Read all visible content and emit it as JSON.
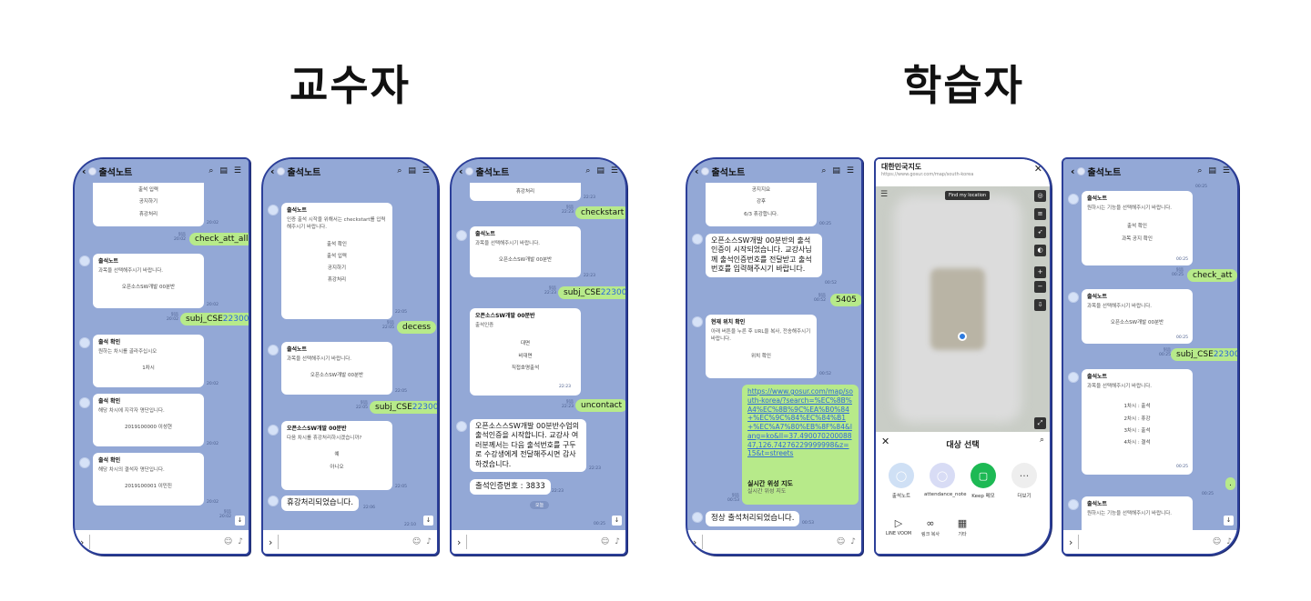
{
  "titles": {
    "professor": "교수자",
    "learner": "학습자"
  },
  "common": {
    "chat_title": "출석노트",
    "read": "읽음"
  },
  "p1": {
    "top_card": [
      "출석 입력",
      "공지하기",
      "휴강처리"
    ],
    "t1": "20:02",
    "b1": "check_att_all",
    "b1t": "20:02",
    "c2_title": "출석노트",
    "c2_text": "과목을 선택해주시기 바랍니다.",
    "c2_opt": "오픈소스SW개발 00분반",
    "c2t": "20:02",
    "b2a": "subj_CSE",
    "b2b": "22300",
    "b2t": "20:02",
    "c3_title": "출석 확인",
    "c3_text": "원하는 차시를 골라주십시오",
    "c3_opt": "1차시",
    "c3t": "20:02",
    "c4_title": "출석 확인",
    "c4_text": "해당 차시에 지각자 명단입니다.",
    "c4_opt": "2019100000 이성현",
    "c4t": "20:02",
    "c5_title": "출석 확인",
    "c5_text": "해당 차시의 결석자 명단입니다.",
    "c5_opt": "2019100001 이민진",
    "c5t": "20:02",
    "last_t": "20:02"
  },
  "p2": {
    "top_t": "22:05",
    "c1_title": "출석노트",
    "c1_text": "인증 출석 시작을 위해서는 checkstart를 입력해주시기 바랍니다.",
    "c1_opts": [
      "출석 확인",
      "출석 입력",
      "공지하기",
      "휴강처리"
    ],
    "c1t": "22:05",
    "b1": "decess",
    "b1t": "22:05",
    "c2_title": "출석노트",
    "c2_text": "과목을 선택해주시기 바랍니다.",
    "c2_opt": "오픈소스SW개발 00분반",
    "c2t": "22:05",
    "b2a": "subj_CSE",
    "b2b": "22300",
    "b2t": "22:05",
    "c3_title": "오픈소스SW개발 00분반",
    "c3_text": "다음 차시를 휴강처리하시겠습니까?",
    "c3_opts": [
      "예",
      "아니오"
    ],
    "c3t": "22:05",
    "w1": "휴강처리되었습니다.",
    "w1t": "22:06",
    "last_t": "22:10"
  },
  "p3": {
    "top_card": "휴강처리",
    "top_t": "22:23",
    "b1": "checkstart",
    "b1t": "22:23",
    "c1_title": "출석노트",
    "c1_text": "과목을 선택해주시기 바랍니다.",
    "c1_opt": "오픈소스SW개발 00분반",
    "c1t": "22:23",
    "b2a": "subj_CSE",
    "b2b": "22300",
    "b2t": "22:23",
    "c2_title": "오픈소스SW개발 00분반",
    "c2_text": "출석인증",
    "c2_opts": [
      "대면",
      "비대면",
      "직접호명출석"
    ],
    "c2t": "22:23",
    "b3": "uncontact",
    "b3t": "22:23",
    "w1": "오픈소스스SW개발 00분반수업의 출석인증을 시작합니다. 교강사 여러분께서는 다음 출석번호를 구두로 수강생에게 전달해주시면 감사하겠습니다.",
    "w1t": "22:23",
    "w2": "출석인증번호 : 3833",
    "w2t": "22:23",
    "pill": "오늘",
    "last_t": "00:25"
  },
  "p4": {
    "top_card": [
      "공지지요",
      "강후",
      "6/3 휴강합니다."
    ],
    "top_t": "00:25",
    "w1": "오픈소스SW개발 00분반의 출석인증이 시작되었습니다. 교강사님께 출석인증번호를 전달받고 출석번호를 입력해주시기 바랍니다.",
    "w1t": "00:52",
    "b1": "5405",
    "b1t": "00:52",
    "c1_title": "현재 위치 확인",
    "c1_text": "아래 버튼을 누른 후 URL을 복사, 전송해주시기 바랍니다.",
    "c1_opt": "위치 확인",
    "c1t": "00:52",
    "link": "https://www.gosur.com/map/south-korea/?search=%EC%8B%A4%EC%8B%9C%EA%B0%84+%EC%9C%84%EC%84%B1+%EC%A7%80%EB%8F%84&lang=ko&ll=37.49007020008847,126.74276229999998&z=15&t=streets",
    "link_title": "실시간 위성 지도",
    "link_sub": "실시간 위성 지도",
    "lt": "00:53",
    "w2": "정상 출석처리되었습니다.",
    "w2t": "00:53"
  },
  "p5": {
    "title": "대한민국지도",
    "url": "https://www.gosur.com/map/south-korea",
    "find": "Find my location",
    "share_title": "대상 선택",
    "apps": [
      "출석노트",
      "attendance_note",
      "Keep 메모",
      "더보기"
    ],
    "acts": [
      "LINE VOOM",
      "링크 복사",
      "기타"
    ]
  },
  "p6": {
    "top_t": "00:25",
    "c1_title": "출석노트",
    "c1_text": "원하시는 기능을 선택해주시기 바랍니다.",
    "c1_opts": [
      "출석 확인",
      "과목 공지 확인"
    ],
    "c1t": "00:25",
    "b1": "check_att",
    "b1t": "00:25",
    "c2_title": "출석노트",
    "c2_text": "과목을 선택해주시기 바랍니다.",
    "c2_opt": "오픈소스SW개발 00분반",
    "c2t": "00:25",
    "b2a": "subj_CSE",
    "b2b": "22300",
    "b2t": "00:25",
    "c3_title": "출석노트",
    "c3_text": "과목을 선택해주시기 바랍니다.",
    "c3_opts": [
      "1차시 : 출석",
      "2차시 : 휴강",
      "3차시 : 출석",
      "4차시 : 결석"
    ],
    "c3t": "00:25",
    "c4_title": "출석노트",
    "c4_text": "원하시는 기능을 선택해주시기 바랍니다.",
    "last_t": "00:25"
  }
}
